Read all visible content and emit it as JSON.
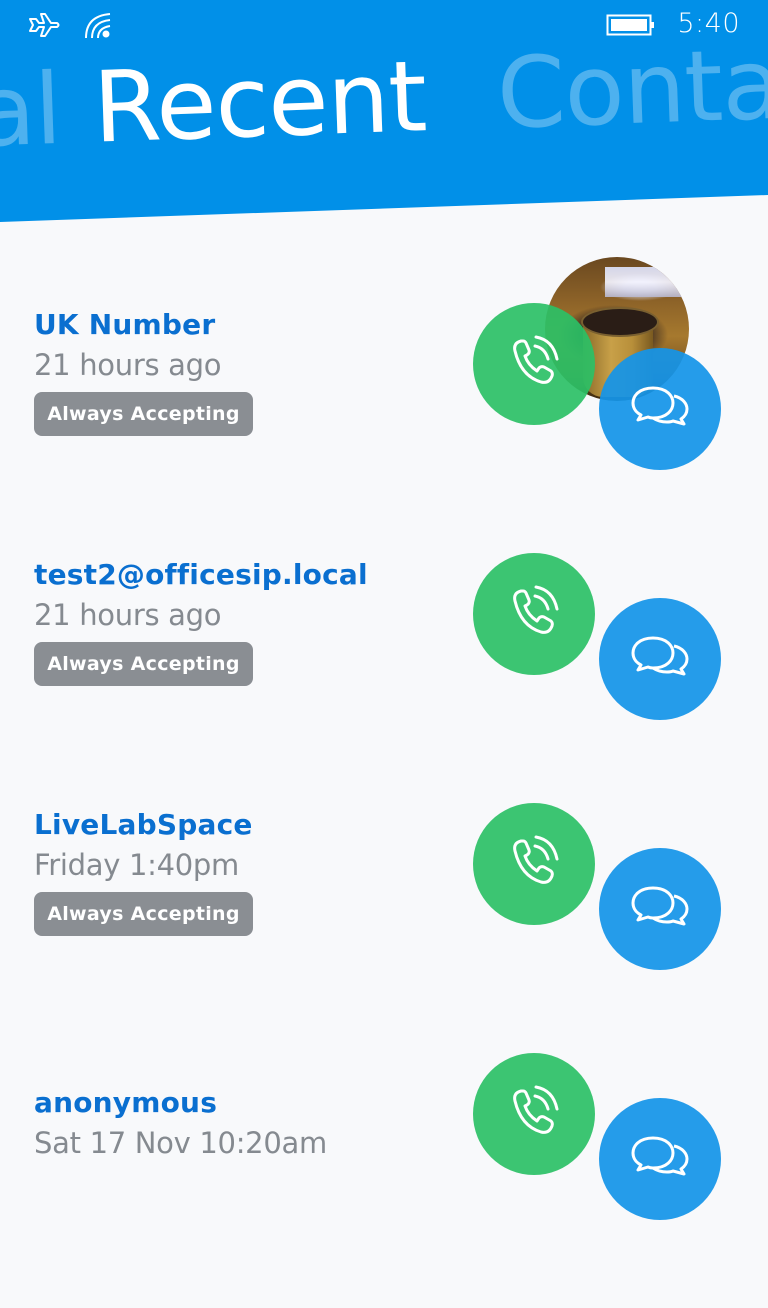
{
  "status_bar": {
    "icons": [
      "airplane-mode-icon",
      "wifi-icon",
      "battery-icon"
    ],
    "time": "5:40"
  },
  "pivot": {
    "prev_label": "al",
    "current_label": "Recent",
    "next_label": "Conta"
  },
  "colors": {
    "header": "#0190e8",
    "name_text": "#0a6fd0",
    "secondary_text": "#858a90",
    "badge": "#8a8e93",
    "call": "#2bc066",
    "message": "#1494e8",
    "background": "#f8f9fb"
  },
  "recent": [
    {
      "name": "UK Number",
      "time": "21 hours ago",
      "badge": "Always Accepting",
      "has_avatar": true
    },
    {
      "name": "test2@officesip.local",
      "time": "21 hours ago",
      "badge": "Always Accepting",
      "has_avatar": false
    },
    {
      "name": "LiveLabSpace",
      "time": "Friday 1:40pm",
      "badge": "Always Accepting",
      "has_avatar": false
    },
    {
      "name": "anonymous",
      "time": "Sat 17 Nov 10:20am",
      "badge": null,
      "has_avatar": false
    }
  ]
}
